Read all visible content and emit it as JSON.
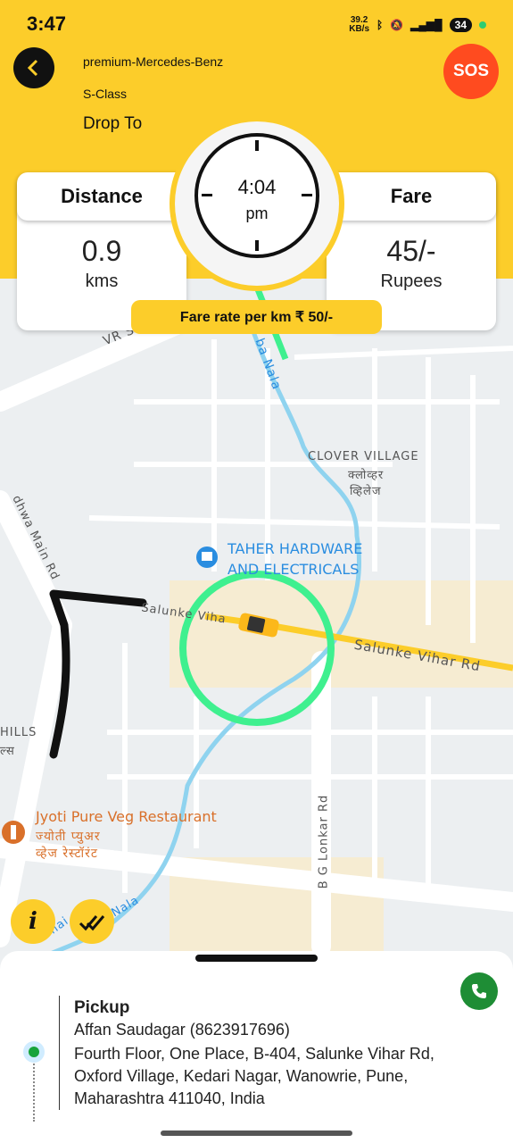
{
  "status": {
    "time": "3:47",
    "net_speed_top": "39.2",
    "net_speed_bottom": "KB/s",
    "battery": "34"
  },
  "header": {
    "car_line1": "premium-Mercedes-Benz",
    "car_line2": "S-Class",
    "drop_label": "Drop To",
    "sos_label": "SOS"
  },
  "trip": {
    "distance_label": "Distance",
    "distance_value": "0.9",
    "distance_unit": "kms",
    "fare_label": "Fare",
    "fare_value": "45/-",
    "fare_unit": "Rupees",
    "clock_time": "4:04",
    "clock_ampm": "pm",
    "fare_rate": "Fare rate per km ₹ 50/-"
  },
  "map": {
    "labels": {
      "vr": "VR S",
      "nala": "ba Nala",
      "clover": "CLOVER VILLAGE",
      "clover_hi1": "क्लोव्हर",
      "clover_hi2": "व्हिलेज",
      "taher1": "TAHER HARDWARE",
      "taher2": "AND ELECTRICALS",
      "main_rd": "dhwa Main Rd",
      "salunke_short": "Salunke Viha",
      "salunke_full": "Salunke Vihar Rd",
      "hills": "HILLS",
      "hills_hi": "ल्स",
      "jyoti": "Jyoti Pure Veg Restaurant",
      "jyoti_hi1": "ज्योती प्युअर",
      "jyoti_hi2": "व्हेज रेस्टॉरंट",
      "lonkar": "B G Lonkar Rd",
      "bhai_nala": "Bhai",
      "nala2": "Nala"
    },
    "colors": {
      "route": "#fccd2a",
      "highlight": "#3ff08f",
      "water": "#8fd3ef",
      "poi_blue": "#2a8de0",
      "poi_orange": "#d9702a"
    }
  },
  "pickup": {
    "title": "Pickup",
    "name": "Affan Saudagar (8623917696)",
    "address": "Fourth Floor, One Place, B-404, Salunke Vihar Rd, Oxford Village, Kedari Nagar, Wanowrie, Pune, Maharashtra 411040, India"
  }
}
